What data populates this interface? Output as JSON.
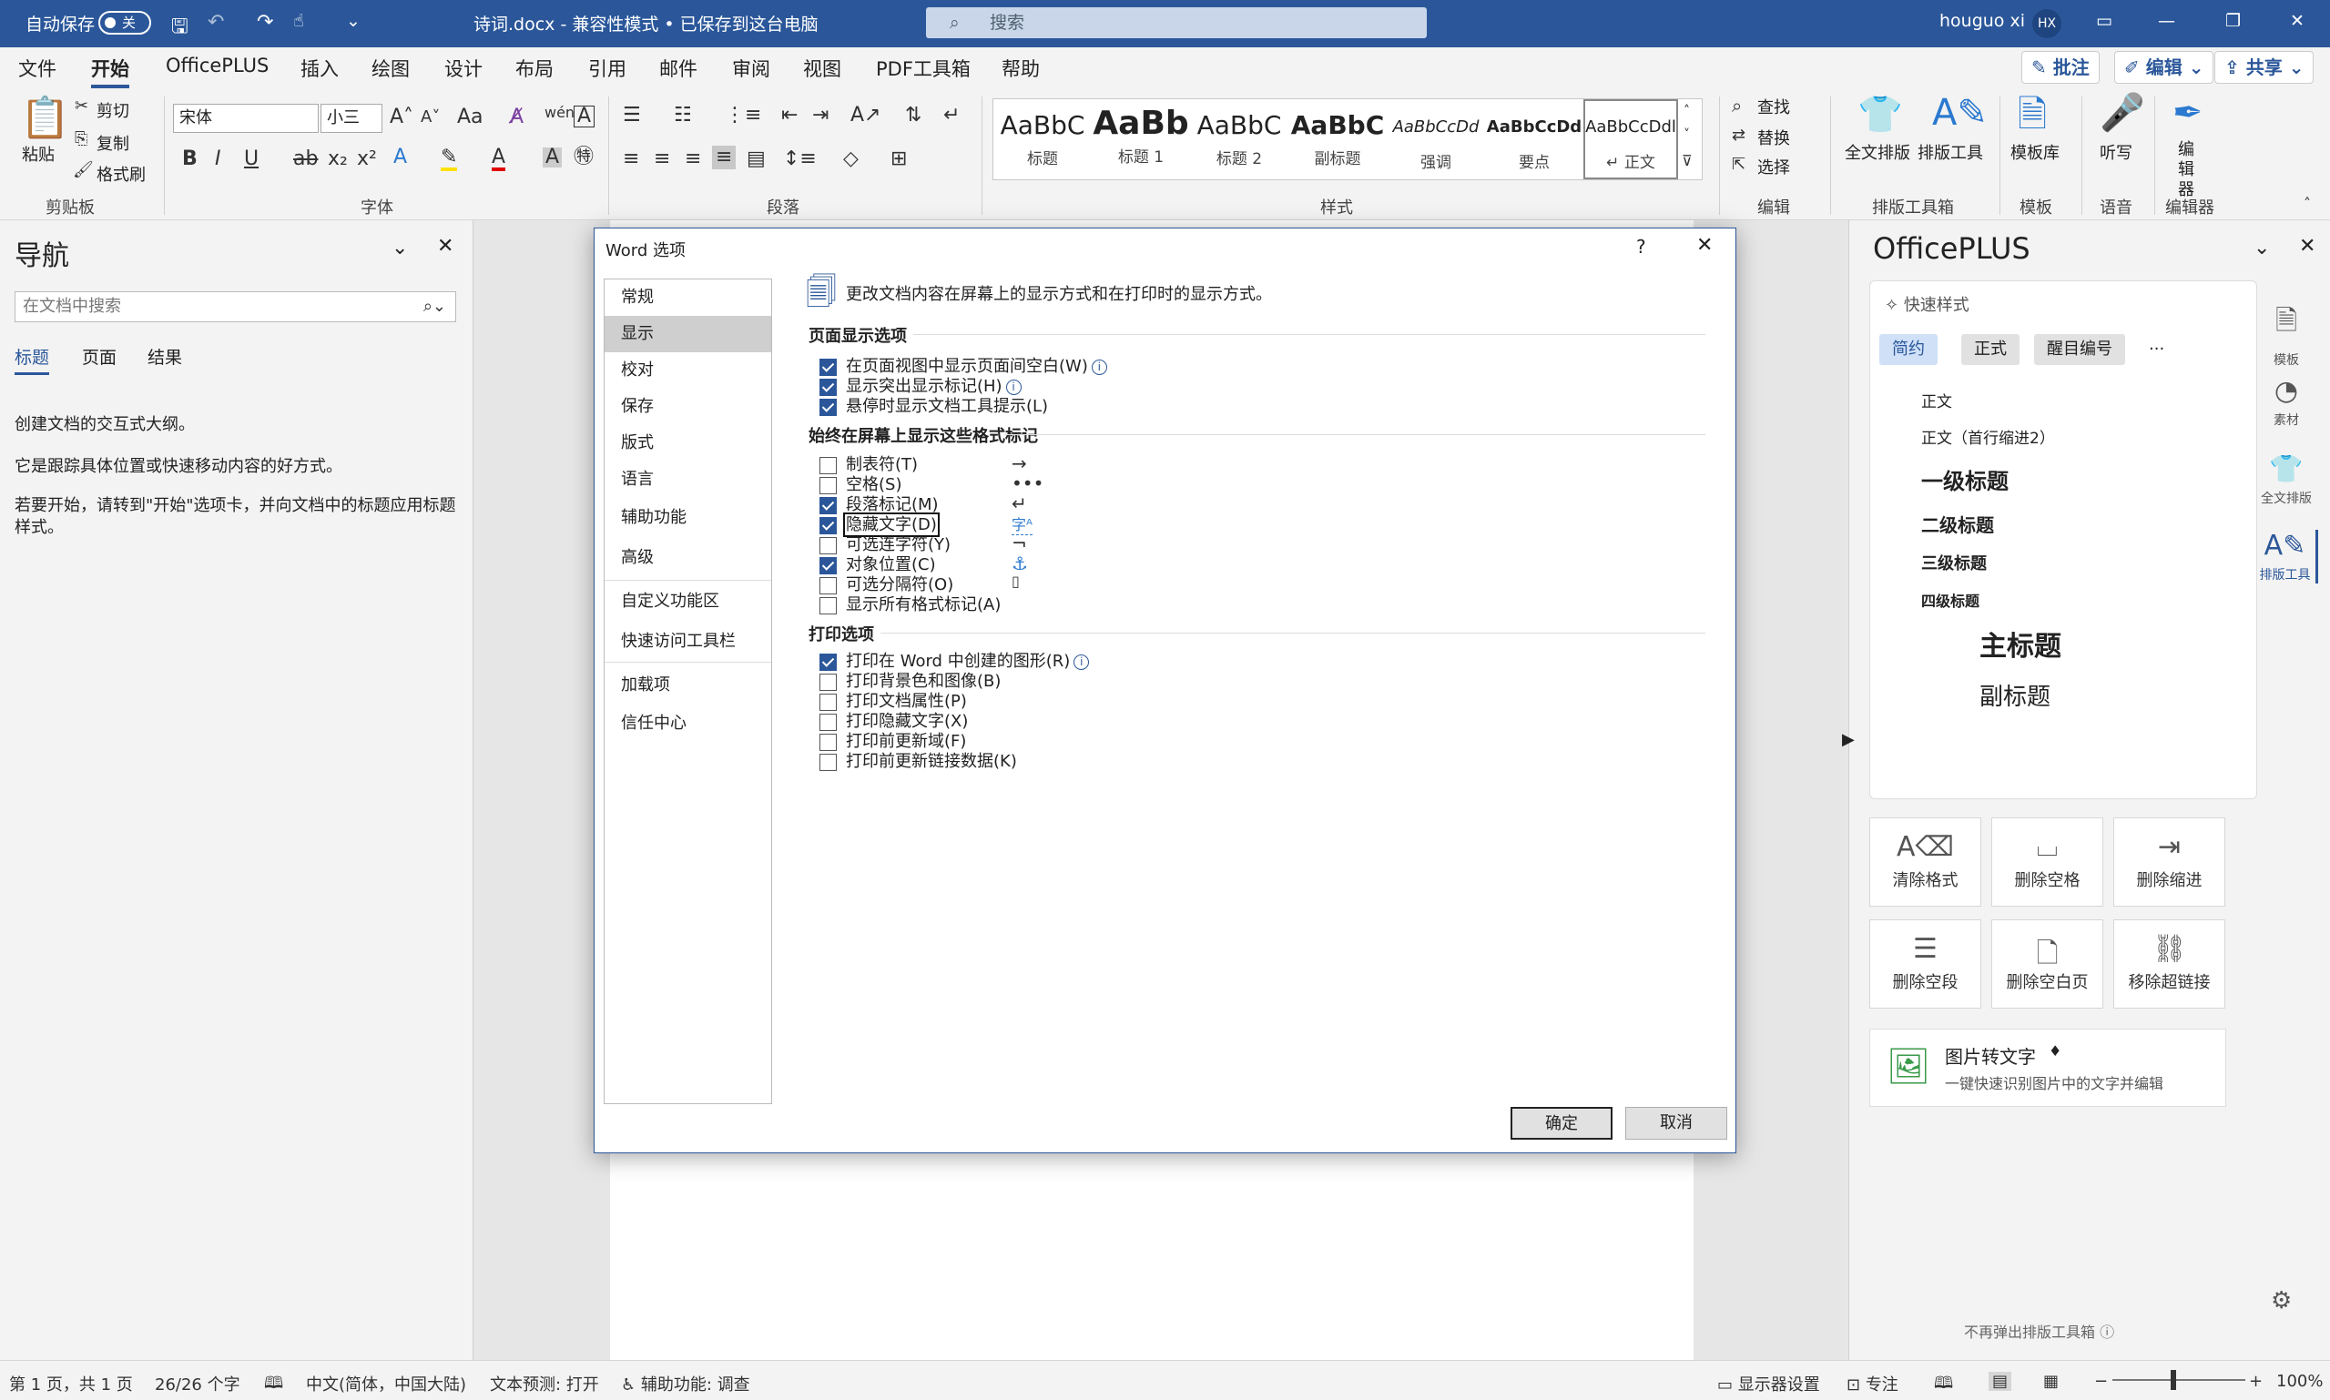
{
  "titlebar": {
    "autosave": "自动保存",
    "autosave_state": "关",
    "doc_title": "诗词.docx  -  兼容性模式 • 已保存到这台电脑",
    "search_placeholder": "搜索",
    "user": "houguo xi",
    "initials": "HX"
  },
  "menu_tabs": [
    "文件",
    "开始",
    "OfficePLUS",
    "插入",
    "绘图",
    "设计",
    "布局",
    "引用",
    "邮件",
    "审阅",
    "视图",
    "PDF工具箱",
    "帮助"
  ],
  "top_buttons": {
    "comment": "批注",
    "edit": "编辑",
    "share": "共享"
  },
  "ribbon": {
    "clipboard": {
      "paste": "粘贴",
      "cut": "剪切",
      "copy": "复制",
      "format_painter": "格式刷",
      "label": "剪贴板"
    },
    "font": {
      "name": "宋体",
      "size": "小三",
      "label": "字体"
    },
    "paragraph": {
      "label": "段落"
    },
    "styles": {
      "label": "样式",
      "items": [
        {
          "preview": "AaBbC",
          "name": "标题"
        },
        {
          "preview": "AaBb",
          "name": "标题 1"
        },
        {
          "preview": "AaBbC",
          "name": "标题 2"
        },
        {
          "preview": "AaBbC",
          "name": "副标题"
        },
        {
          "preview": "AaBbCcDd",
          "name": "强调"
        },
        {
          "preview": "AaBbCcDd",
          "name": "要点"
        },
        {
          "preview": "AaBbCcDdl",
          "name": "↵ 正文"
        }
      ]
    },
    "editing": {
      "find": "查找",
      "replace": "替换",
      "select": "选择",
      "label": "编辑"
    },
    "layout_tools": {
      "full": "全文排版",
      "tools": "排版工具",
      "label": "排版工具箱"
    },
    "template": {
      "lib": "模板库",
      "label": "模板"
    },
    "voice": {
      "dictate": "听写",
      "label": "语音"
    },
    "editor": {
      "name": "编辑器",
      "label": "编辑器"
    }
  },
  "nav": {
    "title": "导航",
    "search_placeholder": "在文档中搜索",
    "tabs": [
      "标题",
      "页面",
      "结果"
    ],
    "p1": "创建文档的交互式大纲。",
    "p2": "它是跟踪具体位置或快速移动内容的好方式。",
    "p3": "若要开始，请转到\"开始\"选项卡，并向文档中的标题应用标题样式。"
  },
  "dialog": {
    "title": "Word 选项",
    "help": "?",
    "categories": [
      "常规",
      "显示",
      "校对",
      "保存",
      "版式",
      "语言",
      "辅助功能",
      "高级",
      "自定义功能区",
      "快速访问工具栏",
      "加载项",
      "信任中心"
    ],
    "header": "更改文档内容在屏幕上的显示方式和在打印时的显示方式。",
    "section1": "页面显示选项",
    "s1_opts": [
      {
        "label": "在页面视图中显示页面间空白(W)",
        "checked": true
      },
      {
        "label": "显示突出显示标记(H)",
        "checked": true
      },
      {
        "label": "悬停时显示文档工具提示(L)",
        "checked": true
      }
    ],
    "section2": "始终在屏幕上显示这些格式标记",
    "s2_opts": [
      {
        "label": "制表符(T)",
        "checked": false,
        "sym": "→"
      },
      {
        "label": "空格(S)",
        "checked": false,
        "sym": "•••"
      },
      {
        "label": "段落标记(M)",
        "checked": true,
        "sym": "↵"
      },
      {
        "label": "隐藏文字(D)",
        "checked": true,
        "sym": "字ᴬ"
      },
      {
        "label": "可选连字符(Y)",
        "checked": false,
        "sym": "¬"
      },
      {
        "label": "对象位置(C)",
        "checked": true,
        "sym": "⚓"
      },
      {
        "label": "可选分隔符(O)",
        "checked": false,
        "sym": "▯"
      },
      {
        "label": "显示所有格式标记(A)",
        "checked": false,
        "sym": ""
      }
    ],
    "section3": "打印选项",
    "s3_opts": [
      {
        "label": "打印在 Word 中创建的图形(R)",
        "checked": true
      },
      {
        "label": "打印背景色和图像(B)",
        "checked": false
      },
      {
        "label": "打印文档属性(P)",
        "checked": false
      },
      {
        "label": "打印隐藏文字(X)",
        "checked": false
      },
      {
        "label": "打印前更新域(F)",
        "checked": false
      },
      {
        "label": "打印前更新链接数据(K)",
        "checked": false
      }
    ],
    "ok": "确定",
    "cancel": "取消"
  },
  "officeplus": {
    "title": "OfficePLUS",
    "quick_styles": "快速样式",
    "qs_tabs": [
      "简约",
      "正式",
      "醒目编号",
      "···"
    ],
    "styles": [
      "正文",
      "正文（首行缩进2）",
      "一级标题",
      "二级标题",
      "三级标题",
      "四级标题",
      "主标题",
      "副标题"
    ],
    "tools": [
      "清除格式",
      "删除空格",
      "删除缩进",
      "删除空段",
      "删除空白页",
      "移除超链接"
    ],
    "ocr_title": "图片转文字",
    "ocr_sub": "一键快速识别图片中的文字并编辑",
    "footer": "不再弹出排版工具箱",
    "side": [
      "模板",
      "素材",
      "全文排版",
      "排版工具"
    ]
  },
  "status": {
    "page": "第 1 页，共 1 页",
    "words": "26/26 个字",
    "lang": "中文(简体，中国大陆)",
    "predict": "文本预测: 打开",
    "access": "辅助功能: 调查",
    "display": "显示器设置",
    "focus": "专注",
    "zoom": "100%"
  }
}
